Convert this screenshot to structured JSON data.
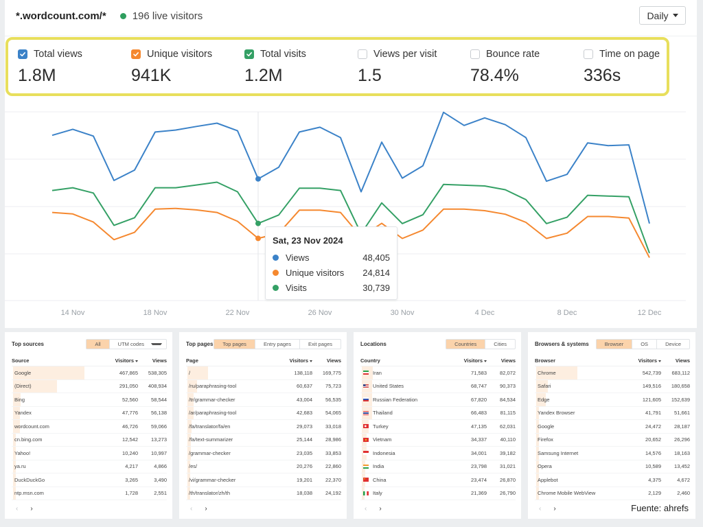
{
  "header": {
    "site": "*.wordcount.com/*",
    "live_visitors": "196 live visitors",
    "interval_select": "Daily"
  },
  "metrics": [
    {
      "label": "Total views",
      "value": "1.8M",
      "checked": true,
      "color": "#3b82c8"
    },
    {
      "label": "Unique visitors",
      "value": "941K",
      "checked": true,
      "color": "#f5882f"
    },
    {
      "label": "Total visits",
      "value": "1.2M",
      "checked": true,
      "color": "#34a065"
    },
    {
      "label": "Views per visit",
      "value": "1.5",
      "checked": false
    },
    {
      "label": "Bounce rate",
      "value": "78.4%",
      "checked": false
    },
    {
      "label": "Time on page",
      "value": "336s",
      "checked": false
    }
  ],
  "chart_data": {
    "type": "line",
    "title": "",
    "xlabel": "",
    "ylabel": "",
    "x": [
      "13 Nov",
      "14 Nov",
      "15 Nov",
      "16 Nov",
      "17 Nov",
      "18 Nov",
      "19 Nov",
      "20 Nov",
      "21 Nov",
      "22 Nov",
      "23 Nov",
      "24 Nov",
      "25 Nov",
      "26 Nov",
      "27 Nov",
      "28 Nov",
      "29 Nov",
      "30 Nov",
      "1 Dec",
      "2 Dec",
      "3 Dec",
      "4 Dec",
      "5 Dec",
      "6 Dec",
      "7 Dec",
      "8 Dec",
      "9 Dec",
      "10 Dec",
      "11 Dec",
      "12 Dec"
    ],
    "x_ticks": [
      "14 Nov",
      "18 Nov",
      "22 Nov",
      "26 Nov",
      "30 Nov",
      "4 Dec",
      "8 Dec",
      "12 Dec"
    ],
    "ylim": [
      0,
      75000
    ],
    "grid": true,
    "y_tick_labels_visible": false,
    "series": [
      {
        "name": "Views",
        "color": "#3b82c8",
        "values": [
          65700,
          68100,
          65400,
          47800,
          51900,
          67000,
          67800,
          69200,
          70500,
          67500,
          48405,
          53000,
          67000,
          68900,
          64800,
          43300,
          63000,
          48700,
          53600,
          74800,
          69600,
          72600,
          69900,
          64800,
          47500,
          50200,
          62700,
          61600,
          61900,
          30700
        ]
      },
      {
        "name": "Unique visitors",
        "color": "#f5882f",
        "values": [
          35100,
          34500,
          31300,
          24300,
          27200,
          36400,
          36700,
          36100,
          35100,
          31600,
          24814,
          26800,
          36000,
          36000,
          35100,
          25400,
          30800,
          24800,
          28100,
          36400,
          36400,
          35800,
          34400,
          31200,
          24800,
          26900,
          33500,
          33500,
          32900,
          17200
        ]
      },
      {
        "name": "Visits",
        "color": "#34a065",
        "values": [
          43800,
          44900,
          42800,
          30000,
          33000,
          44900,
          44900,
          46000,
          47100,
          43300,
          30739,
          34100,
          44700,
          44700,
          43800,
          26700,
          38900,
          30700,
          34200,
          46200,
          45900,
          45600,
          44100,
          40200,
          30700,
          33200,
          41900,
          41600,
          41300,
          19000
        ]
      }
    ],
    "highlight": {
      "x": "23 Nov",
      "title": "Sat, 23 Nov 2024",
      "rows": [
        {
          "name": "Views",
          "value": "48,405",
          "color": "#3b82c8"
        },
        {
          "name": "Unique visitors",
          "value": "24,814",
          "color": "#f5882f"
        },
        {
          "name": "Visits",
          "value": "30,739",
          "color": "#34a065"
        }
      ]
    }
  },
  "panels": [
    {
      "title": "Top sources",
      "tabs": [
        {
          "label": "All",
          "active": true
        },
        {
          "label": "UTM codes",
          "dropdown": true
        }
      ],
      "columns": [
        "Source",
        "Visitors",
        "Views"
      ],
      "rows": [
        {
          "name": "Google",
          "visitors": "467,865",
          "views": "538,305",
          "share": 1.0
        },
        {
          "name": "(Direct)",
          "visitors": "291,050",
          "views": "408,934",
          "share": 0.62
        },
        {
          "name": "Bing",
          "visitors": "52,560",
          "views": "58,544",
          "share": 0.11
        },
        {
          "name": "Yandex",
          "visitors": "47,776",
          "views": "56,138",
          "share": 0.1
        },
        {
          "name": "wordcount.com",
          "visitors": "46,726",
          "views": "59,066",
          "share": 0.1
        },
        {
          "name": "cn.bing.com",
          "visitors": "12,542",
          "views": "13,273",
          "share": 0.03
        },
        {
          "name": "Yahoo!",
          "visitors": "10,240",
          "views": "10,997",
          "share": 0.02
        },
        {
          "name": "ya.ru",
          "visitors": "4,217",
          "views": "4,866",
          "share": 0.01
        },
        {
          "name": "DuckDuckGo",
          "visitors": "3,265",
          "views": "3,490",
          "share": 0.01
        },
        {
          "name": "ntp.msn.com",
          "visitors": "1,728",
          "views": "2,551",
          "share": 0.0
        }
      ]
    },
    {
      "title": "Top pages",
      "tabs": [
        {
          "label": "Top pages",
          "active": true
        },
        {
          "label": "Entry pages"
        },
        {
          "label": "Exit pages"
        }
      ],
      "columns": [
        "Page",
        "Visitors",
        "Views"
      ],
      "rows": [
        {
          "name": "/",
          "visitors": "138,118",
          "views": "169,775",
          "share": 0.29
        },
        {
          "name": "/ru/paraphrasing-tool",
          "visitors": "60,637",
          "views": "75,723",
          "share": 0.13
        },
        {
          "name": "/tr/grammar-checker",
          "visitors": "43,004",
          "views": "56,535",
          "share": 0.09
        },
        {
          "name": "/ar/paraphrasing-tool",
          "visitors": "42,683",
          "views": "54,065",
          "share": 0.09
        },
        {
          "name": "/fa/translator/fa/en",
          "visitors": "29,073",
          "views": "33,018",
          "share": 0.06
        },
        {
          "name": "/fa/text-summarizer",
          "visitors": "25,144",
          "views": "28,986",
          "share": 0.05
        },
        {
          "name": "/grammar-checker",
          "visitors": "23,035",
          "views": "33,853",
          "share": 0.05
        },
        {
          "name": "/es/",
          "visitors": "20,276",
          "views": "22,860",
          "share": 0.04
        },
        {
          "name": "/vi/grammar-checker",
          "visitors": "19,201",
          "views": "22,370",
          "share": 0.04
        },
        {
          "name": "/th/translator/zh/th",
          "visitors": "18,038",
          "views": "24,192",
          "share": 0.04
        }
      ]
    },
    {
      "title": "Locations",
      "tabs": [
        {
          "label": "Countries",
          "active": true
        },
        {
          "label": "Cities"
        }
      ],
      "columns": [
        "Country",
        "Visitors",
        "Views"
      ],
      "rows": [
        {
          "name": "Iran",
          "visitors": "71,583",
          "views": "82,072",
          "share": 0.15,
          "flag": "iran"
        },
        {
          "name": "United States",
          "visitors": "68,747",
          "views": "90,373",
          "share": 0.14,
          "flag": "us"
        },
        {
          "name": "Russian Federation",
          "visitors": "67,820",
          "views": "84,534",
          "share": 0.14,
          "flag": "ru"
        },
        {
          "name": "Thailand",
          "visitors": "66,483",
          "views": "81,115",
          "share": 0.14,
          "flag": "th"
        },
        {
          "name": "Turkey",
          "visitors": "47,135",
          "views": "62,031",
          "share": 0.1,
          "flag": "tr"
        },
        {
          "name": "Vietnam",
          "visitors": "34,337",
          "views": "40,110",
          "share": 0.07,
          "flag": "vn"
        },
        {
          "name": "Indonesia",
          "visitors": "34,001",
          "views": "39,182",
          "share": 0.07,
          "flag": "id"
        },
        {
          "name": "India",
          "visitors": "23,798",
          "views": "31,021",
          "share": 0.05,
          "flag": "in"
        },
        {
          "name": "China",
          "visitors": "23,474",
          "views": "26,870",
          "share": 0.05,
          "flag": "cn"
        },
        {
          "name": "Italy",
          "visitors": "21,369",
          "views": "26,790",
          "share": 0.04,
          "flag": "it"
        }
      ]
    },
    {
      "title": "Browsers & systems",
      "tabs": [
        {
          "label": "Browser",
          "active": true
        },
        {
          "label": "OS"
        },
        {
          "label": "Device"
        }
      ],
      "columns": [
        "Browser",
        "Visitors",
        "Views"
      ],
      "rows": [
        {
          "name": "Chrome",
          "visitors": "542,739",
          "views": "683,112",
          "share": 0.58
        },
        {
          "name": "Safari",
          "visitors": "149,516",
          "views": "180,658",
          "share": 0.16
        },
        {
          "name": "Edge",
          "visitors": "121,605",
          "views": "152,639",
          "share": 0.13
        },
        {
          "name": "Yandex Browser",
          "visitors": "41,791",
          "views": "51,661",
          "share": 0.04
        },
        {
          "name": "Google",
          "visitors": "24,472",
          "views": "28,187",
          "share": 0.03
        },
        {
          "name": "Firefox",
          "visitors": "20,652",
          "views": "26,296",
          "share": 0.02
        },
        {
          "name": "Samsung Internet",
          "visitors": "14,576",
          "views": "18,163",
          "share": 0.02
        },
        {
          "name": "Opera",
          "visitors": "10,589",
          "views": "13,452",
          "share": 0.01
        },
        {
          "name": "Applebot",
          "visitors": "4,375",
          "views": "4,672",
          "share": 0.0
        },
        {
          "name": "Chrome Mobile WebView",
          "visitors": "2,129",
          "views": "2,460",
          "share": 0.0
        }
      ]
    }
  ],
  "pager": {
    "prev": "‹",
    "next": "›"
  },
  "source_credit": "Fuente: ahrefs"
}
